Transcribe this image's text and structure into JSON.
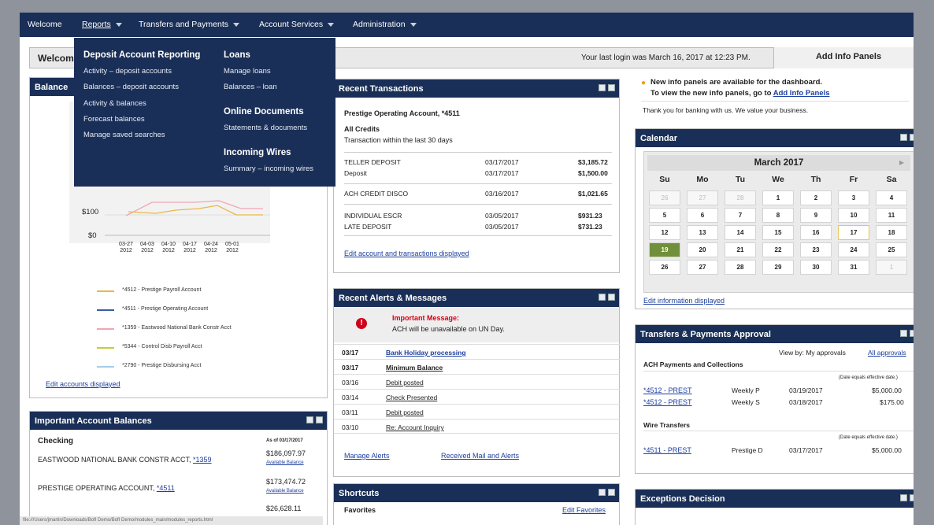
{
  "nav": {
    "items": [
      {
        "label": "Welcome",
        "caret": false
      },
      {
        "label": "Reports",
        "caret": true
      },
      {
        "label": "Transfers and Payments",
        "caret": true
      },
      {
        "label": "Account Services",
        "caret": true
      },
      {
        "label": "Administration",
        "caret": true
      }
    ]
  },
  "welcome": {
    "title": "Welcome",
    "last_login": "Your last login was March 16, 2017 at 12:23 PM.",
    "add_panels": "Add Info Panels"
  },
  "menu": {
    "deposit_heading": "Deposit Account Reporting",
    "deposit_items": [
      "Activity – deposit accounts",
      "Balances – deposit accounts",
      "Activity & balances",
      "Forecast balances",
      "Manage saved searches"
    ],
    "loans_heading": "Loans",
    "loans_items": [
      "Manage loans",
      "Balances – loan"
    ],
    "docs_heading": "Online Documents",
    "docs_items": [
      "Statements & documents"
    ],
    "wires_heading": "Incoming Wires",
    "wires_items": [
      "Summary – incoming wires"
    ]
  },
  "balance_panel": {
    "title": "Balance",
    "y_ticks": [
      "$100",
      "$0"
    ],
    "x_ticks": [
      "03-27 2012",
      "04-03 2012",
      "04-10 2012",
      "04-17 2012",
      "04-24 2012",
      "05-01 2012"
    ],
    "legend": [
      {
        "label": "*4512 - Prestige Payroll Account",
        "color": "#e8b84a"
      },
      {
        "label": "*4511 - Prestige Operating Account",
        "color": "#3b5ba5"
      },
      {
        "label": "*1359 - Eastwood National Bank Constr Acct",
        "color": "#f2a5b5"
      },
      {
        "label": "*5344 - Control Disb Payroll Acct",
        "color": "#c8cc3a"
      },
      {
        "label": "*2790 - Prestige Disbursing Acct",
        "color": "#a5cde8"
      }
    ],
    "edit_link": "Edit accounts displayed"
  },
  "important_balances": {
    "title": "Important Account Balances",
    "section": "Checking",
    "as_of": "As of 03/17/2017",
    "rows": [
      {
        "name": "EASTWOOD NATIONAL BANK CONSTR ACCT, ",
        "link": "*1359",
        "amount": "$186,097.97",
        "sub": "Available Balance"
      },
      {
        "name": "PRESTIGE OPERATING ACCOUNT, ",
        "link": "*4511",
        "amount": "$173,474.72",
        "sub": "Available Balance"
      },
      {
        "name": "",
        "link": "",
        "amount": "$26,628.11",
        "sub": ""
      }
    ],
    "status_bar": "file:///Users/jmartin/Downloads/BofI Demo/BofI Demo/modules_main/modules_reports.html"
  },
  "recent_tx": {
    "title": "Recent Transactions",
    "account": "Prestige Operating Account, *4511",
    "filter": "All Credits",
    "window": "Transaction within the last 30 days",
    "rows": [
      {
        "desc": "TELLER DEPOSIT",
        "date": "03/17/2017",
        "amt": "$3,185.72"
      },
      {
        "desc": "Deposit",
        "date": "03/17/2017",
        "amt": "$1,500.00"
      },
      {
        "desc": "ACH CREDIT DISCO",
        "date": "03/16/2017",
        "amt": "$1,021.65"
      },
      {
        "desc": "INDIVIDUAL ESCR",
        "date": "03/05/2017",
        "amt": "$931.23"
      },
      {
        "desc": "LATE DEPOSIT",
        "date": "03/05/2017",
        "amt": "$731.23"
      }
    ],
    "edit_link": "Edit account and transactions displayed"
  },
  "alerts": {
    "title": "Recent Alerts & Messages",
    "important_label": "Important Message:",
    "important_text": "ACH will be unavailable on UN Day.",
    "rows": [
      {
        "date": "03/17",
        "text": "Bank Holiday processing",
        "bold": true
      },
      {
        "date": "03/17",
        "text": "Minimum Balance",
        "bold": true
      },
      {
        "date": "03/16",
        "text": "Debit posted",
        "bold": false
      },
      {
        "date": "03/14",
        "text": "Check Presented",
        "bold": false
      },
      {
        "date": "03/11",
        "text": "Debit posted",
        "bold": false
      },
      {
        "date": "03/10",
        "text": "Re: Account Inquiry",
        "bold": false
      }
    ],
    "manage_link": "Manage Alerts",
    "mail_link": "Received Mail and Alerts"
  },
  "shortcuts": {
    "title": "Shortcuts",
    "favorites": "Favorites",
    "edit_link": "Edit Favorites"
  },
  "info_panel": {
    "line1": "New info panels are available for the dashboard.",
    "line2_prefix": "To view the new info panels, go to ",
    "line2_link": "Add Info Panels",
    "thanks": "Thank you for banking with us. We value your business."
  },
  "calendar": {
    "title": "Calendar",
    "month": "March 2017",
    "days": [
      "Su",
      "Mo",
      "Tu",
      "We",
      "Th",
      "Fr",
      "Sa"
    ],
    "weeks": [
      [
        "26",
        "27",
        "28",
        "1",
        "2",
        "3",
        "4"
      ],
      [
        "5",
        "6",
        "7",
        "8",
        "9",
        "10",
        "11"
      ],
      [
        "12",
        "13",
        "14",
        "15",
        "16",
        "17",
        "18"
      ],
      [
        "19",
        "20",
        "21",
        "22",
        "23",
        "24",
        "25"
      ],
      [
        "26",
        "27",
        "28",
        "29",
        "30",
        "31",
        "1"
      ]
    ],
    "edit_link": "Edit information displayed"
  },
  "approval": {
    "title": "Transfers & Payments Approval",
    "view_by": "View by: My approvals",
    "all_link": "All approvals",
    "ach_heading": "ACH Payments and Collections",
    "note": "(Date equals effective date.)",
    "ach_rows": [
      {
        "acct": "*4512 - PREST",
        "type": "Weekly P",
        "date": "03/19/2017",
        "amt": "$5,000.00"
      },
      {
        "acct": "*4512 - PREST",
        "type": "Weekly S",
        "date": "03/18/2017",
        "amt": "$175.00"
      }
    ],
    "wire_heading": "Wire Transfers",
    "wire_rows": [
      {
        "acct": "*4511 - PREST",
        "type": "Prestige D",
        "date": "03/17/2017",
        "amt": "$5,000.00"
      }
    ]
  },
  "exceptions": {
    "title": "Exceptions Decision"
  }
}
